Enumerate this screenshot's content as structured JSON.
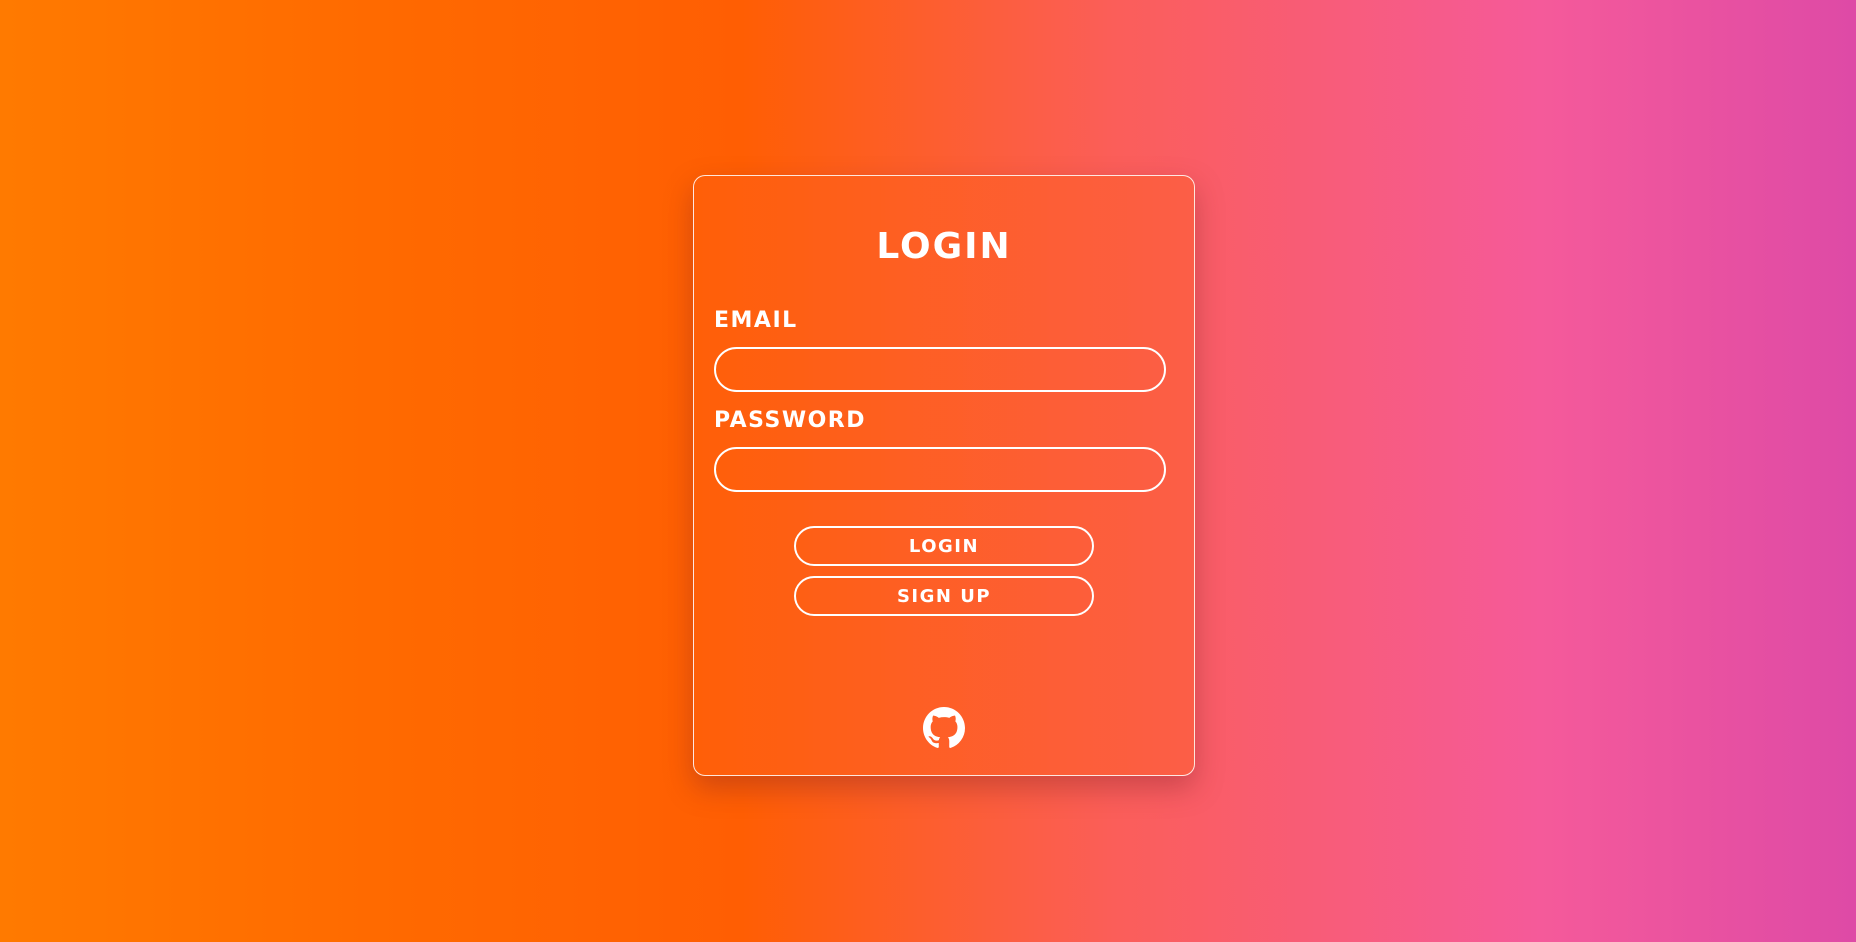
{
  "form": {
    "title": "Login",
    "email_label": "Email",
    "email_value": "",
    "password_label": "Password",
    "password_value": "",
    "login_button": "Login",
    "signup_button": "Sign up"
  },
  "icons": {
    "footer": "github-icon"
  },
  "colors": {
    "gradient_start": "#ff7a00",
    "gradient_mid": "#ff5e03",
    "gradient_pink": "#f55a9a",
    "gradient_end": "#de4aa6",
    "text": "#ffffff"
  }
}
